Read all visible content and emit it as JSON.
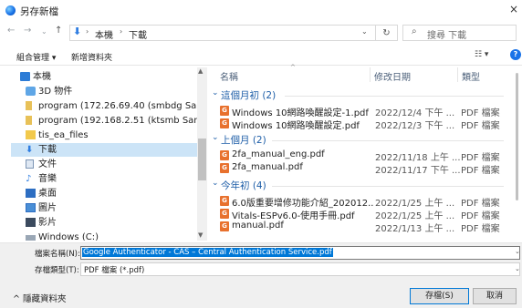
{
  "window": {
    "title": "另存新檔",
    "close": "×"
  },
  "address": {
    "crumbs": [
      "本機",
      "下載"
    ],
    "search_placeholder": "搜尋 下載"
  },
  "toolbar": {
    "organize": "組合管理 ▾",
    "new_folder": "新增資料夾",
    "view": "☷ ▾",
    "help": "?"
  },
  "nav": {
    "items": [
      {
        "label": "本機",
        "icon": "computer-icon"
      },
      {
        "label": "3D 物件",
        "icon": "3d-objects-icon"
      },
      {
        "label": "program (172.26.69.40 (smbdg Samba",
        "icon": "network-drive-icon"
      },
      {
        "label": "program (192.168.2.51 (ktsmb Samba",
        "icon": "network-drive-icon"
      },
      {
        "label": "tis_ea_files",
        "icon": "folder-icon"
      },
      {
        "label": "下載",
        "icon": "downloads-icon"
      },
      {
        "label": "文件",
        "icon": "documents-icon"
      },
      {
        "label": "音樂",
        "icon": "music-icon"
      },
      {
        "label": "桌面",
        "icon": "desktop-icon"
      },
      {
        "label": "圖片",
        "icon": "pictures-icon"
      },
      {
        "label": "影片",
        "icon": "videos-icon"
      },
      {
        "label": "Windows (C:)",
        "icon": "drive-icon"
      }
    ]
  },
  "columns": {
    "name": "名稱",
    "date": "修改日期",
    "type": "類型"
  },
  "groups": [
    {
      "label": "這個月初 (2)",
      "files": [
        {
          "name": "Windows 10網路喚醒設定-1.pdf",
          "date": "2022/12/4 下午 ...",
          "type": "PDF 檔案"
        },
        {
          "name": "Windows 10網路喚醒設定.pdf",
          "date": "2022/12/3 下午 ...",
          "type": "PDF 檔案"
        }
      ]
    },
    {
      "label": "上個月 (2)",
      "files": [
        {
          "name": "2fa_manual_eng.pdf",
          "date": "2022/11/18 上午 ...",
          "type": "PDF 檔案"
        },
        {
          "name": "2fa_manual.pdf",
          "date": "2022/11/17 下午 ...",
          "type": "PDF 檔案"
        }
      ]
    },
    {
      "label": "今年初 (4)",
      "files": [
        {
          "name": "6.0版重要增修功能介紹_202012...",
          "date": "2022/1/25 上午 ...",
          "type": "PDF 檔案"
        },
        {
          "name": "Vitals-ESPv6.0-使用手冊.pdf",
          "date": "2022/1/25 上午 ...",
          "type": "PDF 檔案"
        },
        {
          "name": "manual.pdf",
          "date": "2022/1/13 上午 ...",
          "type": "PDF 檔案"
        }
      ]
    }
  ],
  "form": {
    "filename_label": "檔案名稱(N):",
    "filename_value": "Google Authenticator - CAS – Central Authentication Service.pdf",
    "filetype_label": "存檔類型(T):",
    "filetype_value": "PDF 檔案 (*.pdf)",
    "hide_folders": "隱藏資料夾",
    "save": "存檔(S)",
    "cancel": "取消"
  }
}
